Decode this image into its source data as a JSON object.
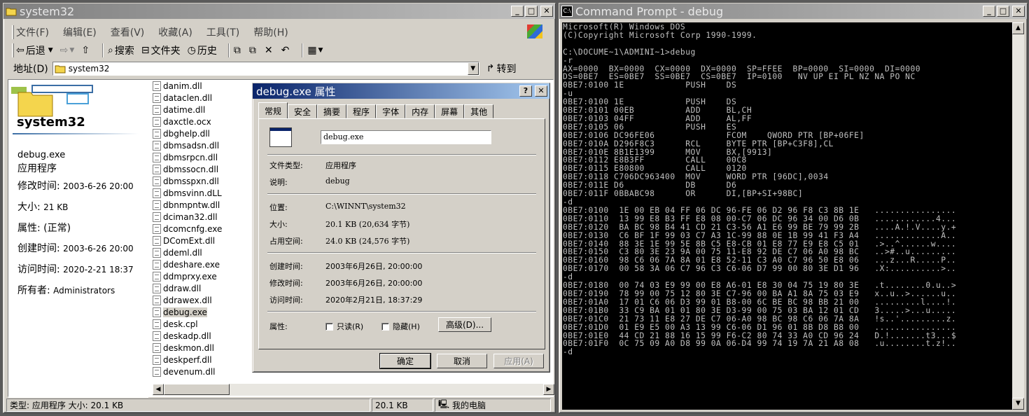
{
  "explorer": {
    "title": "system32",
    "menu": [
      "文件(F)",
      "编辑(E)",
      "查看(V)",
      "收藏(A)",
      "工具(T)",
      "帮助(H)"
    ],
    "toolbar": {
      "back": "后退",
      "search": "搜索",
      "folders": "文件夹",
      "history": "历史"
    },
    "address": {
      "label": "地址(D)",
      "value": "system32",
      "go": "转到"
    },
    "left_pane": {
      "folder_name": "system32",
      "file_name": "debug.exe",
      "file_type": "应用程序",
      "modified_label": "修改时间:",
      "modified": "2003-6-26 20:00",
      "size_label": "大小:",
      "size": "21 KB",
      "attr_label": "属性:",
      "attr": "(正常)",
      "created_label": "创建时间:",
      "created": "2003-6-26 20:00",
      "accessed_label": "访问时间:",
      "accessed": "2020-2-21 18:37",
      "owner_label": "所有者:",
      "owner": "Administrators"
    },
    "files": [
      "danim.dll",
      "dataclen.dll",
      "datime.dll",
      "daxctle.ocx",
      "dbghelp.dll",
      "dbmsadsn.dll",
      "dbmsrpcn.dll",
      "dbmssocn.dll",
      "dbmsspxn.dll",
      "dbmsvinn.dLL",
      "dbnmpntw.dll",
      "dciman32.dll",
      "dcomcnfg.exe",
      "DComExt.dll",
      "ddeml.dll",
      "ddeshare.exe",
      "ddmprxy.exe",
      "ddraw.dll",
      "ddrawex.dll",
      "debug.exe",
      "desk.cpl",
      "deskadp.dll",
      "deskmon.dll",
      "deskperf.dll",
      "devenum.dll"
    ],
    "selected_file": "debug.exe",
    "status": {
      "info": "类型: 应用程序 大小: 20.1 KB",
      "size": "20.1 KB",
      "zone": "我的电脑"
    }
  },
  "properties": {
    "title": "debug.exe 属性",
    "tabs": [
      "常规",
      "安全",
      "摘要",
      "程序",
      "字体",
      "内存",
      "屏幕",
      "其他"
    ],
    "active_tab": "常规",
    "name": "debug.exe",
    "type_label": "文件类型:",
    "type": "应用程序",
    "desc_label": "说明:",
    "desc": "debug",
    "location_label": "位置:",
    "location": "C:\\WINNT\\system32",
    "size_label": "大小:",
    "size": "20.1 KB (20,634 字节)",
    "disk_label": "占用空间:",
    "disk": "24.0 KB (24,576 字节)",
    "created_label": "创建时间:",
    "created": "2003年6月26日, 20:00:00",
    "modified_label": "修改时间:",
    "modified": "2003年6月26日, 20:00:00",
    "accessed_label": "访问时间:",
    "accessed": "2020年2月21日, 18:37:29",
    "attr_label": "属性:",
    "readonly": "只读(R)",
    "hidden": "隐藏(H)",
    "advanced": "高级(D)...",
    "ok": "确定",
    "cancel": "取消",
    "apply": "应用(A)"
  },
  "cmd": {
    "title": "Command Prompt - debug",
    "lines": [
      "Microsoft(R) Windows DOS",
      "(C)Copyright Microsoft Corp 1990-1999.",
      "",
      "C:\\DOCUME~1\\ADMINI~1>debug",
      "-r",
      "AX=0000  BX=0000  CX=0000  DX=0000  SP=FFEE  BP=0000  SI=0000  DI=0000",
      "DS=0BE7  ES=0BE7  SS=0BE7  CS=0BE7  IP=0100   NV UP EI PL NZ NA PO NC",
      "0BE7:0100 1E            PUSH    DS",
      "-u",
      "0BE7:0100 1E            PUSH    DS",
      "0BE7:0101 00EB          ADD     BL,CH",
      "0BE7:0103 04FF          ADD     AL,FF",
      "0BE7:0105 06            PUSH    ES",
      "0BE7:0106 DC96FE06              FCOM    QWORD PTR [BP+06FE]",
      "0BE7:010A D296F8C3      RCL     BYTE PTR [BP+C3F8],CL",
      "0BE7:010E 8B1E1399      MOV     BX,[9913]",
      "0BE7:0112 E8B3FF        CALL    00C8",
      "0BE7:0115 E80800        CALL    0120",
      "0BE7:0118 C706DC963400  MOV     WORD PTR [96DC],0034",
      "0BE7:011E D6            DB      D6",
      "0BE7:011F 0BBABC98      OR      DI,[BP+SI+98BC]",
      "-d",
      "0BE7:0100  1E 00 EB 04 FF 06 DC 96-FE 06 D2 96 F8 C3 8B 1E   ................",
      "0BE7:0110  13 99 E8 B3 FF E8 08 00-C7 06 DC 96 34 00 D6 0B   ............4...",
      "0BE7:0120  BA BC 98 B4 41 CD 21 C3-56 A1 E6 99 BE 79 99 2B   ....A.!.V....y.+",
      "0BE7:0130  C6 BF 1F 99 03 C7 A3 1C-99 88 0E 1B 99 41 F3 A4   .............A..",
      "0BE7:0140  88 3E 1E 99 5E 8B C5 E8-CB 01 E8 77 E9 E8 C5 01   .>..^......w....",
      "0BE7:0150  C3 80 3E 23 9A 00 75 11-E8 92 DE C7 06 A0 98 BC   ..>#..u.........",
      "0BE7:0160  98 C6 06 7A 8A 01 E8 52-11 C3 A0 C7 96 50 E8 06   ...z...R.....P..",
      "0BE7:0170  00 58 3A 06 C7 96 C3 C6-06 D7 99 00 80 3E D1 96   .X:..........>..",
      "-d",
      "0BE7:0180  00 74 03 E9 99 00 E8 A6-01 E8 30 04 75 19 80 3E   .t........0.u..>",
      "0BE7:0190  78 99 00 75 12 80 3E C7-96 00 BA A1 8A 75 03 E9   x..u..>......u..",
      "0BE7:01A0  17 01 C6 06 D3 99 01 B8-00 6C BE BC 98 BB 21 00   .........l....!.",
      "0BE7:01B0  33 C9 BA 01 01 80 3E D3-99 00 75 03 BA 12 01 CD   3.....>...u.....",
      "0BE7:01C0  21 73 11 E8 27 DE C7 06-A0 98 BC 98 C6 06 7A 8A   !s..'.........z.",
      "0BE7:01D0  01 E9 E5 00 A3 13 99 C6-06 D1 96 01 8B D8 B8 00   ................",
      "0BE7:01E0  44 CD 21 88 16 15 99 F6-C2 80 74 33 A0 CD 96 24   D.!.......t3...$",
      "0BE7:01F0  0C 75 09 A0 D8 99 0A 06-D4 99 74 19 7A 21 A8 08   .u........t.z!..",
      "-d"
    ]
  },
  "colors": {
    "active_title": "#0a246a",
    "inactive_title": "#808080",
    "face": "#d4d0c8",
    "console_bg": "#000000",
    "console_fg": "#c0c0c0"
  }
}
